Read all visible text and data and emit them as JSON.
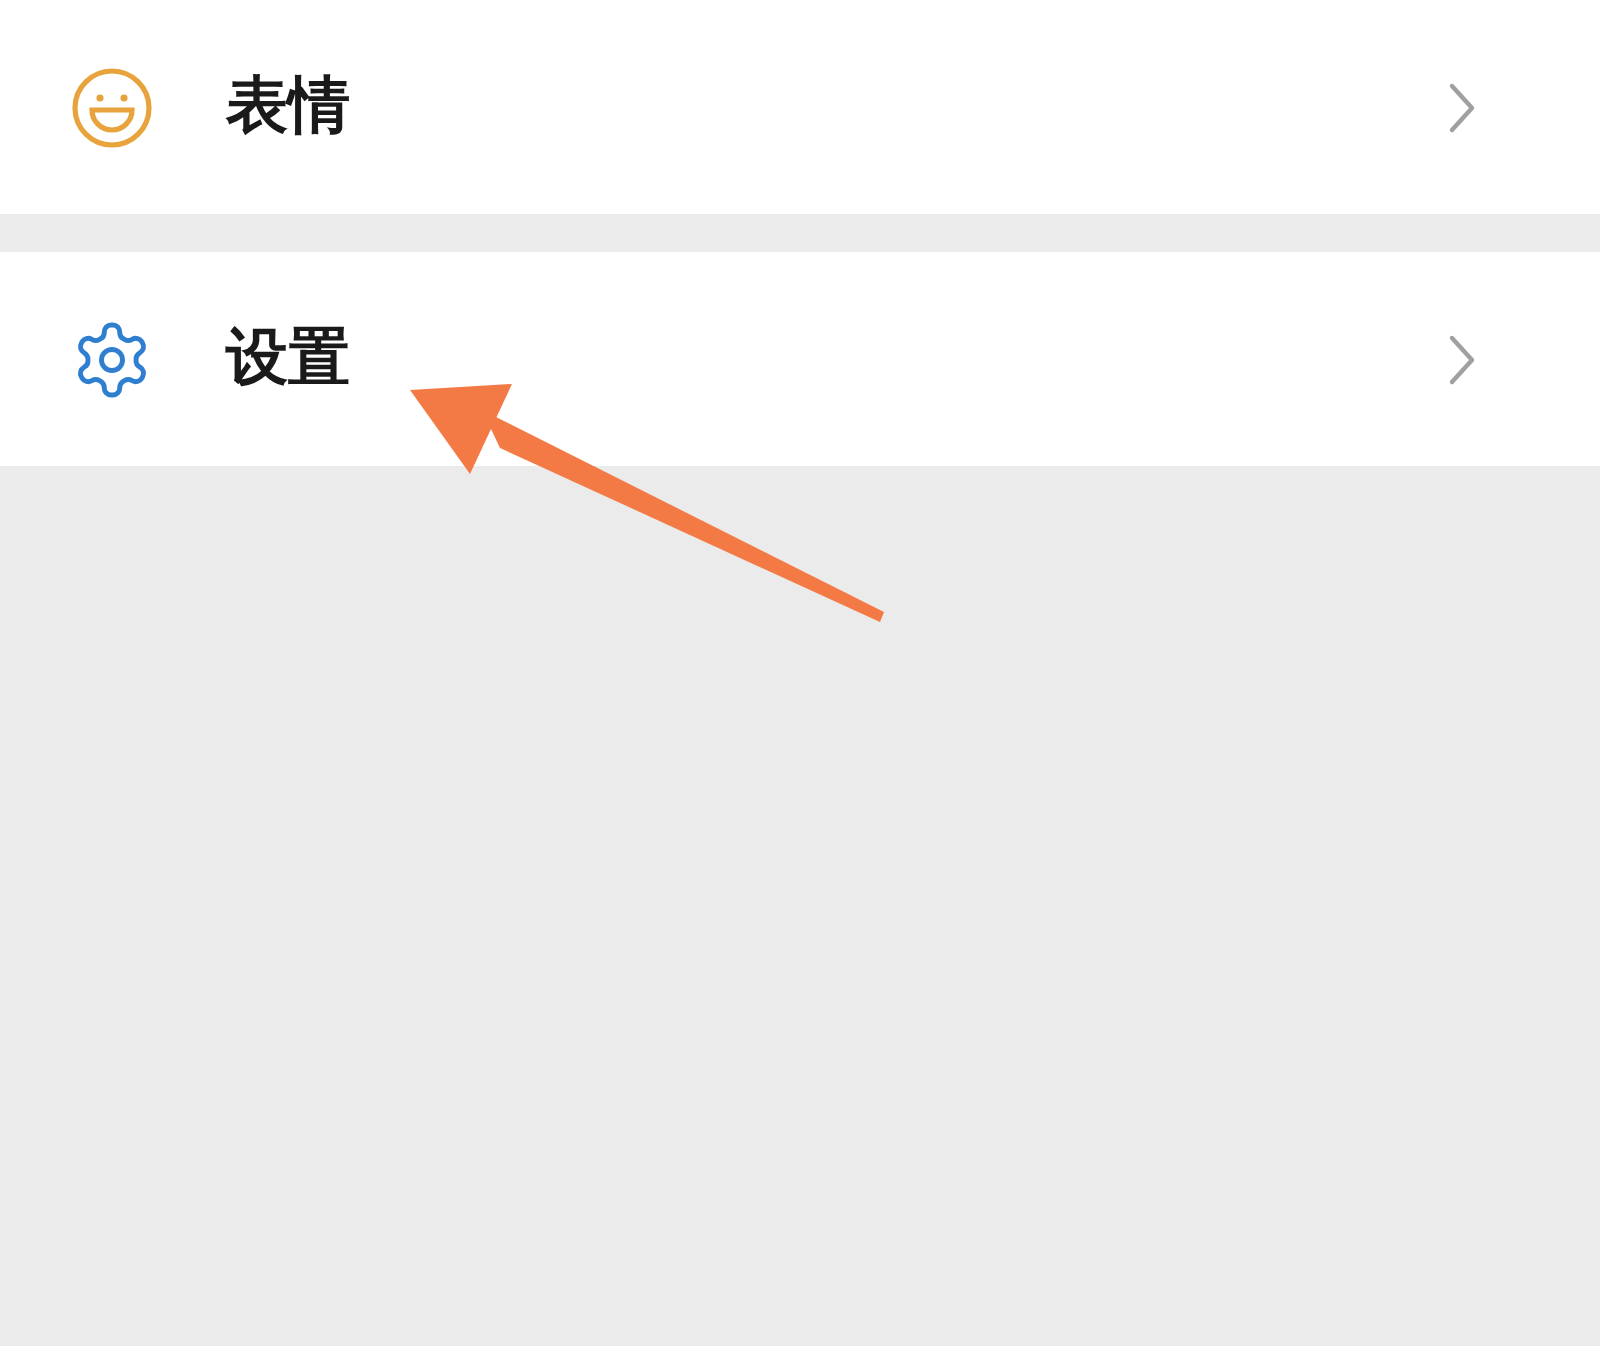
{
  "menu": [
    {
      "kind": "emoji",
      "label": "表情"
    },
    {
      "kind": "settings",
      "label": "设置"
    }
  ]
}
